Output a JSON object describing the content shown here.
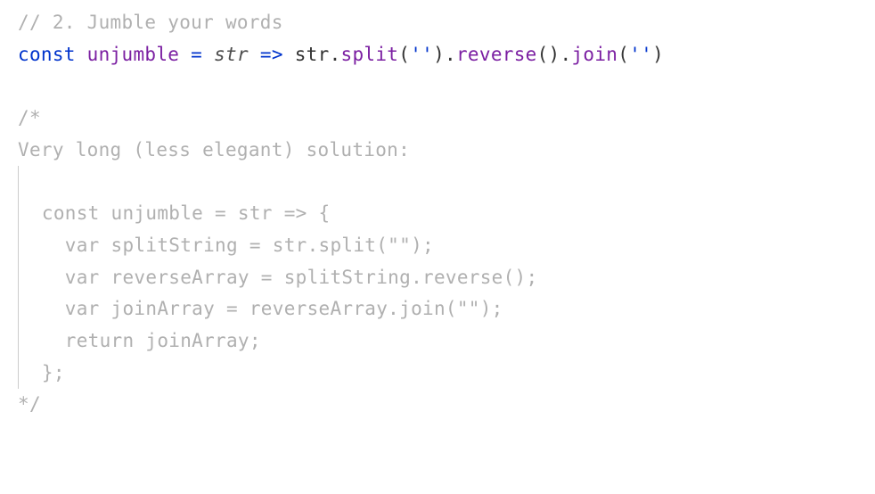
{
  "code": {
    "line1": {
      "comment": "// 2. Jumble your words"
    },
    "line2": {
      "const_kw": "const",
      "space1": " ",
      "funcname": "unjumble",
      "space2": " ",
      "equals": "=",
      "space3": " ",
      "param": "str",
      "space4": " ",
      "arrow": "=>",
      "space5": " ",
      "str_ref": "str",
      "dot1": ".",
      "split": "split",
      "paren1": "(",
      "str_lit1": "''",
      "paren2": ")",
      "dot2": ".",
      "reverse": "reverse",
      "paren3": "(",
      "paren4": ")",
      "dot3": ".",
      "join": "join",
      "paren5": "(",
      "str_lit2": "''",
      "paren6": ")"
    },
    "line4": {
      "comment": "/*"
    },
    "line5": {
      "comment": "Very long (less elegant) solution:"
    },
    "line7": {
      "comment": "  const unjumble = str => {"
    },
    "line8": {
      "comment": "    var splitString = str.split(\"\");"
    },
    "line9": {
      "comment": "    var reverseArray = splitString.reverse();"
    },
    "line10": {
      "comment": "    var joinArray = reverseArray.join(\"\");"
    },
    "line11": {
      "comment": "    return joinArray;"
    },
    "line12": {
      "comment": "  };"
    },
    "line13": {
      "comment": "*/"
    }
  }
}
